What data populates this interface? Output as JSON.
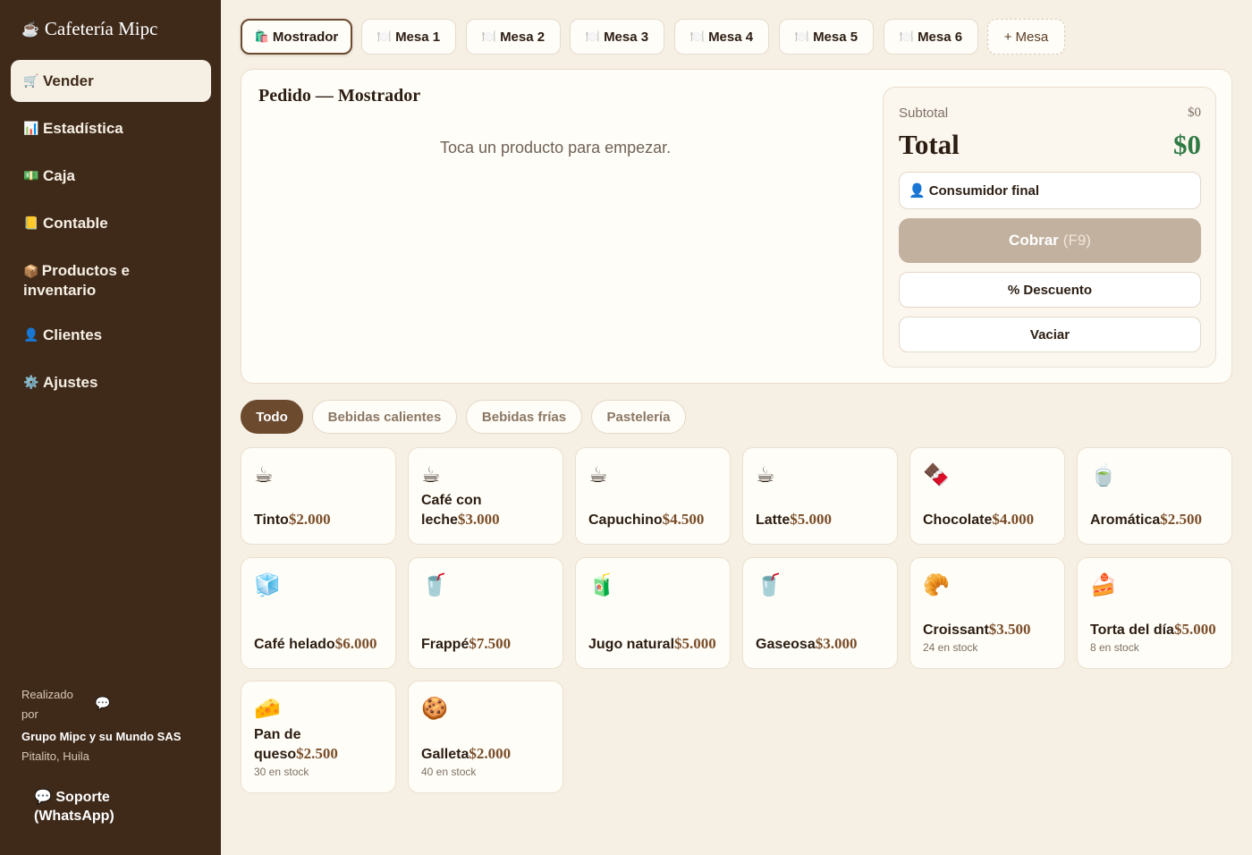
{
  "sidebar": {
    "brand": "Cafetería Mipc",
    "items": [
      {
        "icon": "🛒",
        "label": "Vender"
      },
      {
        "icon": "📊",
        "label": "Estadística"
      },
      {
        "icon": "💵",
        "label": "Caja"
      },
      {
        "icon": "📒",
        "label": "Contable"
      },
      {
        "icon": "📦",
        "label": "Productos e inventario"
      },
      {
        "icon": "👤",
        "label": "Clientes"
      },
      {
        "icon": "⚙️",
        "label": "Ajustes"
      }
    ],
    "made_by_line1": "Realizado",
    "made_by_line2": "por",
    "company": "Grupo Mipc y su Mundo SAS",
    "location": "Pitalito, Huila",
    "support": "💬 Soporte (WhatsApp)",
    "chat_icon": "💬"
  },
  "tabs": [
    {
      "icon": "🛍️",
      "label": "Mostrador"
    },
    {
      "icon": "🍽️",
      "label": "Mesa 1"
    },
    {
      "icon": "🍽️",
      "label": "Mesa 2"
    },
    {
      "icon": "🍽️",
      "label": "Mesa 3"
    },
    {
      "icon": "🍽️",
      "label": "Mesa 4"
    },
    {
      "icon": "🍽️",
      "label": "Mesa 5"
    },
    {
      "icon": "🍽️",
      "label": "Mesa 6"
    },
    {
      "icon": "+",
      "label": "Mesa"
    }
  ],
  "order": {
    "title": "Pedido — Mostrador",
    "empty_message": "Toca un producto para empezar.",
    "subtotal_label": "Subtotal",
    "subtotal_value": "$0",
    "total_label": "Total",
    "total_value": "$0",
    "customer_icon": "👤",
    "customer": "Consumidor final",
    "charge_label": "Cobrar",
    "charge_key": "(F9)",
    "discount_label": "% Descuento",
    "clear_label": "Vaciar"
  },
  "categories": [
    "Todo",
    "Bebidas calientes",
    "Bebidas frías",
    "Pastelería"
  ],
  "products": [
    {
      "emoji": "☕",
      "name": "Tinto",
      "price": "$2.000",
      "stock": ""
    },
    {
      "emoji": "☕",
      "name": "Café con leche",
      "price": "$3.000",
      "stock": ""
    },
    {
      "emoji": "☕",
      "name": "Capuchino",
      "price": "$4.500",
      "stock": ""
    },
    {
      "emoji": "☕",
      "name": "Latte",
      "price": "$5.000",
      "stock": ""
    },
    {
      "emoji": "🍫",
      "name": "Chocolate",
      "price": "$4.000",
      "stock": ""
    },
    {
      "emoji": "🍵",
      "name": "Aromática",
      "price": "$2.500",
      "stock": ""
    },
    {
      "emoji": "🧊",
      "name": "Café helado",
      "price": "$6.000",
      "stock": ""
    },
    {
      "emoji": "🥤",
      "name": "Frappé",
      "price": "$7.500",
      "stock": ""
    },
    {
      "emoji": "🧃",
      "name": "Jugo natural",
      "price": "$5.000",
      "stock": ""
    },
    {
      "emoji": "🥤",
      "name": "Gaseosa",
      "price": "$3.000",
      "stock": ""
    },
    {
      "emoji": "🥐",
      "name": "Croissant",
      "price": "$3.500",
      "stock": "24 en stock"
    },
    {
      "emoji": "🍰",
      "name": "Torta del día",
      "price": "$5.000",
      "stock": "8 en stock"
    },
    {
      "emoji": "🧀",
      "name": "Pan de queso",
      "price": "$2.500",
      "stock": "30 en stock"
    },
    {
      "emoji": "🍪",
      "name": "Galleta",
      "price": "$2.000",
      "stock": "40 en stock"
    }
  ]
}
